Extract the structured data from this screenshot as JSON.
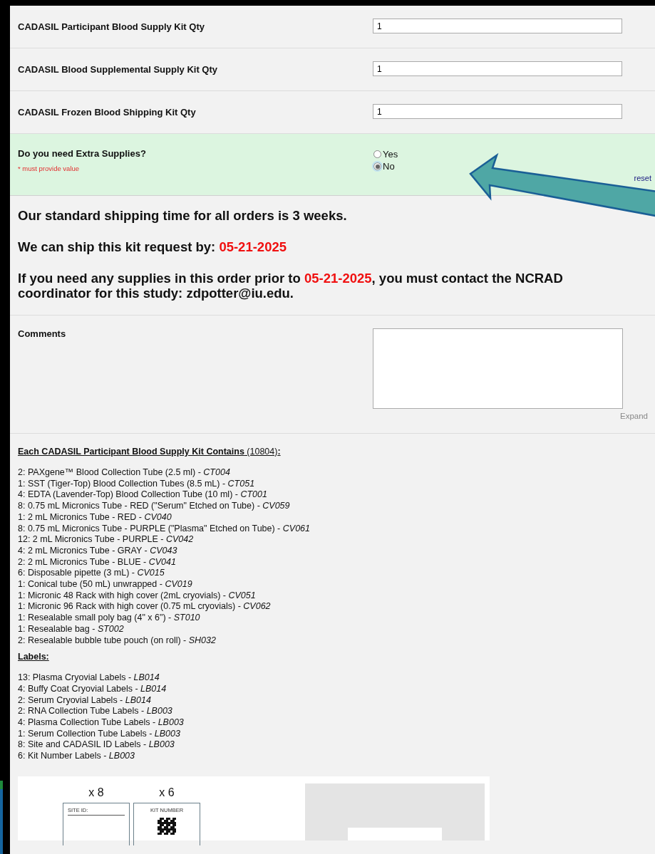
{
  "quantity_rows": [
    {
      "label": "CADASIL Participant Blood Supply Kit Qty",
      "value": "1"
    },
    {
      "label": "CADASIL Blood Supplemental Supply Kit Qty",
      "value": "1"
    },
    {
      "label": "CADASIL Frozen Blood Shipping Kit Qty",
      "value": "1"
    }
  ],
  "extra_supplies": {
    "label": "Do you need Extra Supplies?",
    "required_note": "* must provide value",
    "reset": "reset",
    "options": [
      {
        "label": "Yes",
        "selected": false
      },
      {
        "label": "No",
        "selected": true
      }
    ]
  },
  "shipping_info": [
    [
      {
        "text": "Our standard shipping time for all orders is 3 weeks.",
        "highlight": false
      }
    ],
    [
      {
        "text": "We can ship this kit request by: ",
        "highlight": false
      },
      {
        "text": "05-21-2025",
        "highlight": true
      }
    ],
    [
      {
        "text": "If you need any supplies in this order prior to ",
        "highlight": false
      },
      {
        "text": "05-21-2025",
        "highlight": true
      },
      {
        "text": ", you must contact the NCRAD coordinator for this study: zdpotter@iu.edu.",
        "highlight": false
      }
    ]
  ],
  "comments": {
    "label": "Comments",
    "expand": "Expand"
  },
  "kit_contents": {
    "heading": "**Each CADASIL Participant Blood Supply Kit Contains** (10804)**:**",
    "items": [
      "2: PAXgene™ Blood Collection Tube (2.5 ml) - *CT004*",
      "1: SST (Tiger-Top) Blood Collection Tubes (8.5 mL) - *CT051*",
      "4: EDTA (Lavender-Top) Blood Collection Tube (10 ml) - *CT001*",
      "8: 0.75 mL Micronics Tube - RED (\"Serum\" Etched on Tube) - *CV059*",
      "1: 2 mL Micronics Tube - RED - *CV040*",
      "8: 0.75 mL Micronics Tube - PURPLE (\"Plasma\" Etched on Tube) - *CV061*",
      "12: 2 mL Micronics Tube - PURPLE - *CV042*",
      "4: 2 mL Micronics Tube - GRAY - *CV043*",
      "2: 2 mL Micronics Tube - BLUE - *CV041*",
      "6: Disposable pipette (3 mL) - *CV015*",
      "1: Conical tube (50 mL) unwrapped - *CV019*",
      "1: Micronic 48 Rack with high cover (2mL cryovials) - *CV051*",
      "1: Micronic 96 Rack with high cover (0.75 mL cryovials) - *CV062*",
      "1: Resealable small poly bag (4\" x 6\") - *ST010*",
      "1: Resealable bag - *ST002*",
      "2: Resealable bubble tube pouch (on roll) - *SH032*"
    ]
  },
  "labels": {
    "heading": "Labels:",
    "items": [
      "13: Plasma Cryovial Labels - *LB014*",
      "4: Buffy Coat Cryovial Labels - *LB014*",
      "2: Serum Cryovial Labels - *LB014*",
      "2: RNA Collection Tube Labels - *LB003*",
      "4: Plasma Collection Tube Labels - *LB003*",
      "1: Serum Collection Tube Labels - *LB003*",
      "8: Site and CADASIL ID Labels - *LB003*",
      "6: Kit Number Labels - *LB003*"
    ]
  },
  "kit_picture": {
    "label_sheets": [
      {
        "count": "x 8",
        "title": "SITE ID:",
        "kind": "field"
      },
      {
        "count": "x 6",
        "title": "KIT NUMBER",
        "kind": "barcode"
      }
    ]
  }
}
